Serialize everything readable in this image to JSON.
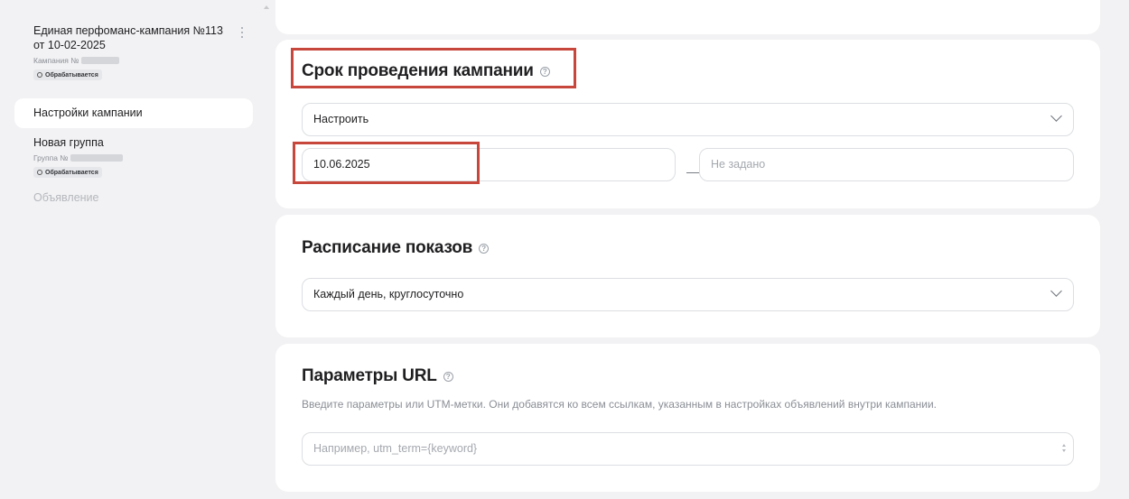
{
  "sidebar": {
    "campaign": {
      "title": "Единая перфоманс-кампания №113 от 10-02-2025",
      "id_label": "Кампания №",
      "status": "Обрабатывается"
    },
    "nav_settings_label": "Настройки кампании",
    "group": {
      "title": "Новая группа",
      "id_label": "Группа №",
      "status": "Обрабатывается"
    },
    "nav_ad_label": "Объявление"
  },
  "period": {
    "title": "Срок проведения кампании",
    "mode_value": "Настроить",
    "start_date": "10.06.2025",
    "separator": "—",
    "end_placeholder": "Не задано"
  },
  "schedule": {
    "title": "Расписание показов",
    "value": "Каждый день, круглосуточно"
  },
  "url_params": {
    "title": "Параметры URL",
    "description": "Введите параметры или UTM-метки. Они добавятся ко всем ссылкам, указанным в настройках объявлений внутри кампании.",
    "placeholder": "Например, utm_term={keyword}"
  },
  "icons": {
    "help": "question-circle-icon",
    "chevron": "chevron-down-icon",
    "more": "kebab-menu-icon",
    "status": "status-clock-icon"
  },
  "colors": {
    "annotation": "#c8473d",
    "background": "#f2f2f4",
    "card": "#ffffff"
  }
}
